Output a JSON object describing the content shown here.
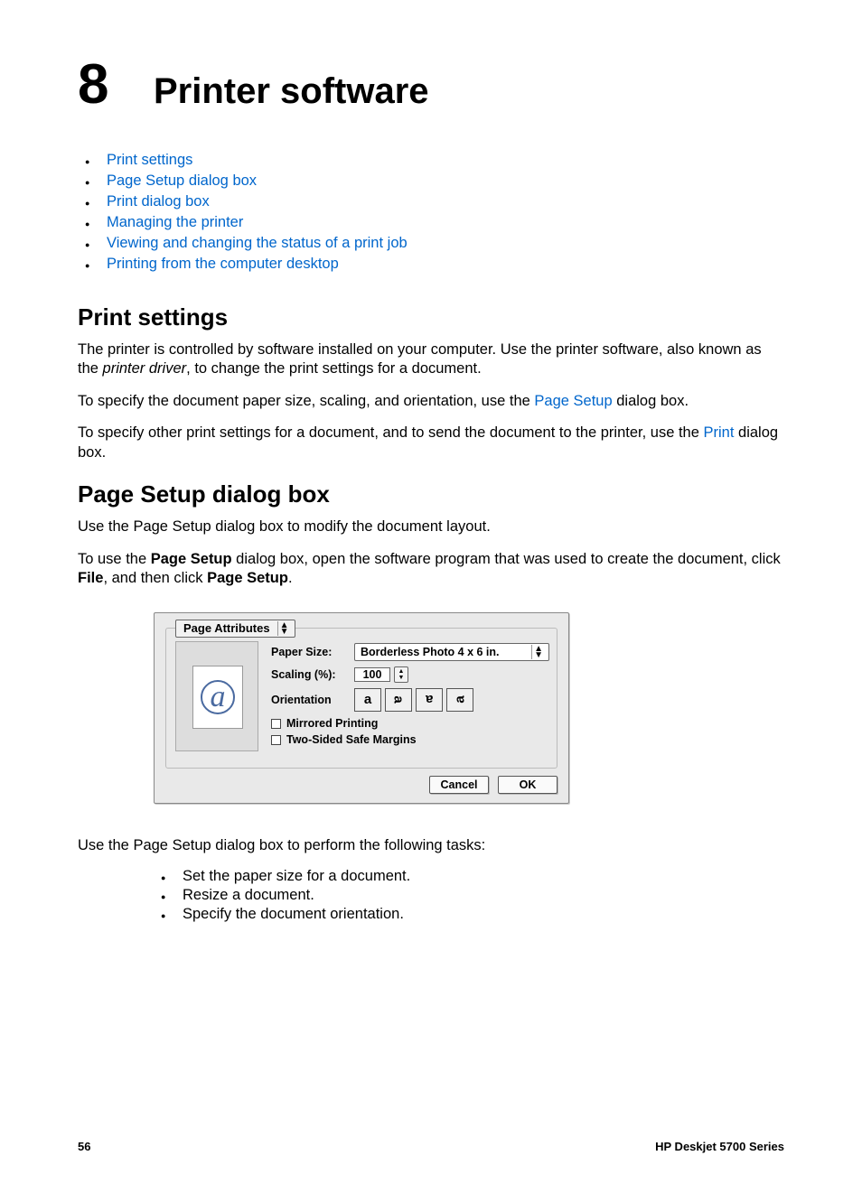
{
  "chapter": {
    "number": "8",
    "title": "Printer software"
  },
  "toc": [
    "Print settings",
    "Page Setup dialog box",
    "Print dialog box",
    "Managing the printer",
    "Viewing and changing the status of a print job",
    "Printing from the computer desktop"
  ],
  "section1": {
    "heading": "Print settings",
    "p1a": "The printer is controlled by software installed on your computer. Use the printer software, also known as the ",
    "p1i": "printer driver",
    "p1b": ", to change the print settings for a document.",
    "p2a": "To specify the document paper size, scaling, and orientation, use the ",
    "p2link": "Page Setup",
    "p2b": " dialog box.",
    "p3a": "To specify other print settings for a document, and to send the document to the printer, use the ",
    "p3link": "Print",
    "p3b": " dialog box."
  },
  "section2": {
    "heading": "Page Setup dialog box",
    "p1": "Use the Page Setup dialog box to modify the document layout.",
    "p2a": "To use the ",
    "p2b1": "Page Setup",
    "p2c": " dialog box, open the software program that was used to create the document, click ",
    "p2b2": "File",
    "p2d": ", and then click ",
    "p2b3": "Page Setup",
    "p2e": ".",
    "after": "Use the Page Setup dialog box to perform the following tasks:",
    "tasks": [
      "Set the paper size for a document.",
      "Resize a document.",
      "Specify the document orientation."
    ]
  },
  "dialog": {
    "tab": "Page Attributes",
    "paper_label": "Paper Size:",
    "paper_value": "Borderless Photo 4 x 6 in.",
    "scaling_label": "Scaling (%):",
    "scaling_value": "100",
    "orient_label": "Orientation",
    "mirrored": "Mirrored Printing",
    "twosided": "Two-Sided Safe Margins",
    "cancel": "Cancel",
    "ok": "OK"
  },
  "footer": {
    "page": "56",
    "product": "HP Deskjet 5700 Series"
  }
}
